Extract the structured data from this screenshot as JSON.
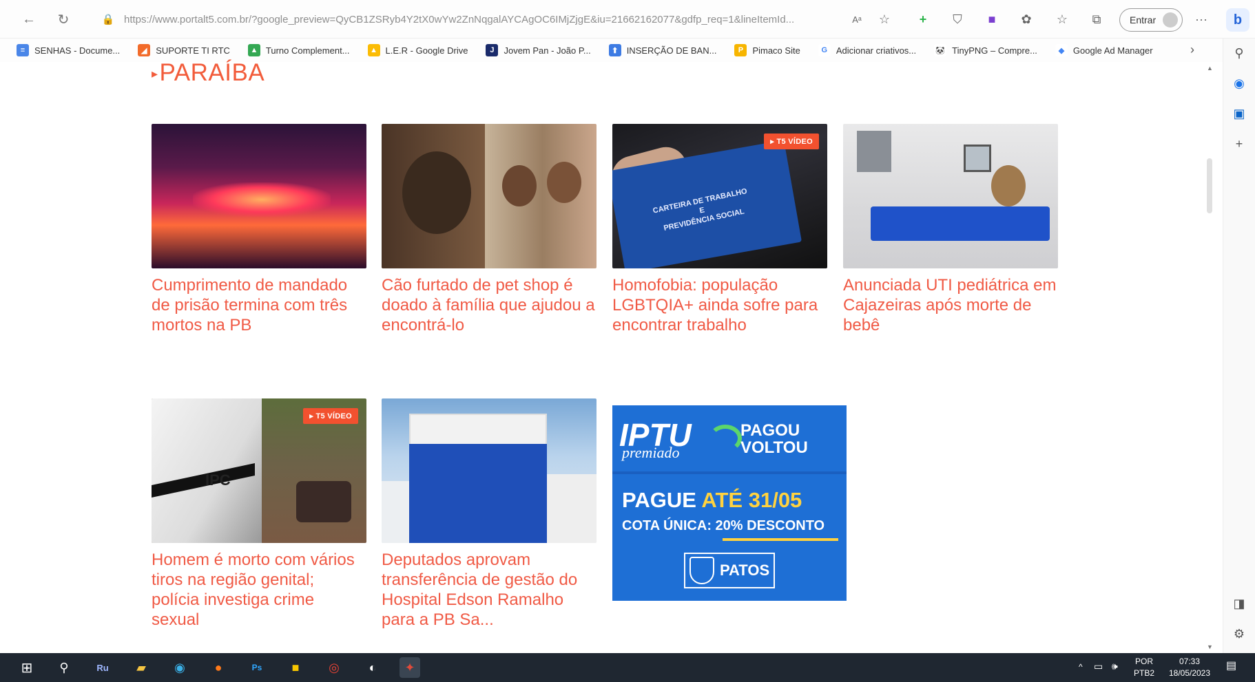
{
  "browser": {
    "url_host": "https://www.portalt5.com.br/",
    "url_rest": "?google_preview=QyCB1ZSRyb4Y2tX0wYw2ZnNqgalAYCAgOC6IMjZjgE&iu=21662162077&gdfp_req=1&lineItemId...",
    "signin_label": "Entrar"
  },
  "bookmarks": [
    {
      "label": "SENHAS - Docume...",
      "color": "#4a86e8",
      "glyph": "≡"
    },
    {
      "label": "SUPORTE TI RTC",
      "color": "#f26b2a",
      "glyph": "◢"
    },
    {
      "label": "Turno Complement...",
      "color": "#34a853",
      "glyph": "▲"
    },
    {
      "label": "L.E.R - Google Drive",
      "color": "#fbbc05",
      "glyph": "▲"
    },
    {
      "label": "Jovem Pan - João P...",
      "color": "#1a2b6b",
      "glyph": "J"
    },
    {
      "label": "INSERÇÃO DE BAN...",
      "color": "#3d7be3",
      "glyph": "⬆"
    },
    {
      "label": "Pimaco Site",
      "color": "#f7b500",
      "glyph": "P"
    },
    {
      "label": "Adicionar criativos...",
      "color": "#ffffff",
      "glyph": "G"
    },
    {
      "label": "TinyPNG – Compre...",
      "color": "#ffffff",
      "glyph": "🐼"
    },
    {
      "label": "Google Ad Manager",
      "color": "#ffffff",
      "glyph": "◆"
    }
  ],
  "section": {
    "title": "PARAÍBA"
  },
  "articles": [
    {
      "headline": "Cumprimento de mandado de prisão termina com três mortos na PB",
      "badge": ""
    },
    {
      "headline": "Cão furtado de pet shop é doado à família que ajudou a encontrá-lo",
      "badge": ""
    },
    {
      "headline": "Homofobia: população LGBTQIA+ ainda sofre para encontrar trabalho",
      "badge": "▸ T5 VÍDEO"
    },
    {
      "headline": "Anunciada UTI pediátrica em Cajazeiras após morte de bebê",
      "badge": ""
    },
    {
      "headline": "Homem é morto com vários tiros na região genital; polícia investiga crime sexual",
      "badge": "▸ T5 VÍDEO"
    },
    {
      "headline": "Deputados aprovam transferência de gestão do Hospital Edson Ramalho para a PB Sa...",
      "badge": ""
    }
  ],
  "ad": {
    "iptu": "IPTU",
    "premiado": "premiado",
    "pagou": "PAGOU",
    "voltou": "VOLTOU",
    "pague": "PAGUE ",
    "ate": "ATÉ 31/05",
    "cota": "COTA ÚNICA: 20% DESCONTO",
    "patos": "PATOS"
  },
  "taskbar": {
    "lang1": "POR",
    "lang2": "PTB2",
    "time": "07:33",
    "date": "18/05/2023"
  }
}
